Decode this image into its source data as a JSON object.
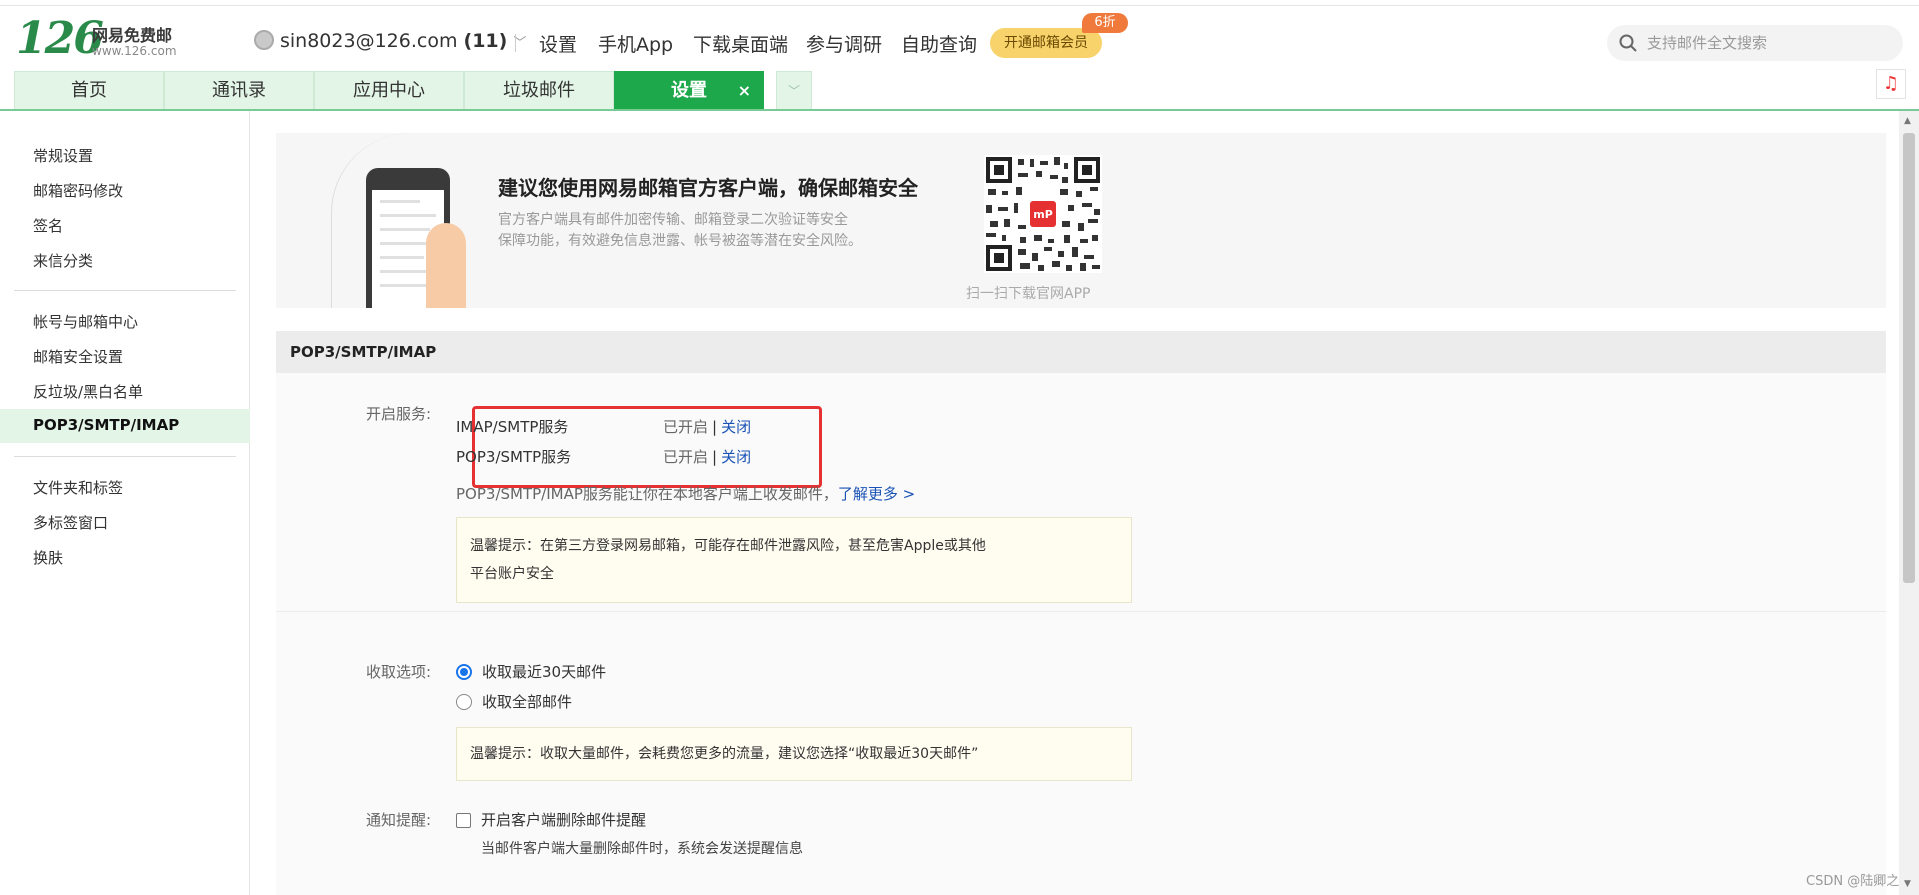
{
  "header": {
    "logo_number": "126",
    "logo_name": "网易免费邮",
    "logo_url": "www.126.com",
    "account_email": "sin8023@126.com",
    "account_count": "(11)",
    "nav": [
      "设置",
      "手机App",
      "下载桌面端",
      "参与调研",
      "自助查询"
    ],
    "vip_label": "开通邮箱会员",
    "vip_badge": "6折",
    "search_placeholder": "支持邮件全文搜索"
  },
  "tabs": [
    {
      "label": "首页"
    },
    {
      "label": "通讯录"
    },
    {
      "label": "应用中心"
    },
    {
      "label": "垃圾邮件"
    },
    {
      "label": "设置",
      "active": true,
      "close": "×"
    }
  ],
  "sidebar": {
    "group1": [
      "常规设置",
      "邮箱密码修改",
      "签名",
      "来信分类"
    ],
    "group2": [
      "帐号与邮箱中心",
      "邮箱安全设置",
      "反垃圾/黑白名单",
      "POP3/SMTP/IMAP"
    ],
    "group3": [
      "文件夹和标签",
      "多标签窗口",
      "换肤"
    ],
    "active_item": "POP3/SMTP/IMAP"
  },
  "banner": {
    "title": "建议您使用网易邮箱官方客户端，确保邮箱安全",
    "desc_line1": "官方客户端具有邮件加密传输、邮箱登录二次验证等安全",
    "desc_line2": "保障功能，有效避免信息泄露、帐号被盗等潜在安全风险。",
    "qr_caption": "扫一扫下载官网APP"
  },
  "section": {
    "title": "POP3/SMTP/IMAP",
    "service_label": "开启服务:",
    "services": [
      {
        "name": "IMAP/SMTP服务",
        "status": "已开启",
        "separator": "|",
        "action": "关闭"
      },
      {
        "name": "POP3/SMTP服务",
        "status": "已开启",
        "separator": "|",
        "action": "关闭"
      }
    ],
    "desc": "POP3/SMTP/IMAP服务能让你在本地客户端上收发邮件，",
    "desc_link": "了解更多 >",
    "tip1_line1": "温馨提示：在第三方登录网易邮箱，可能存在邮件泄露风险，甚至危害Apple或其他",
    "tip1_line2": "平台账户安全",
    "receive_label": "收取选项:",
    "receive_options": [
      {
        "label": "收取最近30天邮件",
        "checked": true
      },
      {
        "label": "收取全部邮件",
        "checked": false
      }
    ],
    "tip2": "温馨提示：收取大量邮件，会耗费您更多的流量，建议您选择“收取最近30天邮件”",
    "notify_label": "通知提醒:",
    "notify_checkbox_label": "开启客户端删除邮件提醒",
    "notify_checked": false,
    "notify_note": "当邮件客户端大量删除邮件时，系统会发送提醒信息"
  },
  "watermark": "CSDN @陆卿之"
}
